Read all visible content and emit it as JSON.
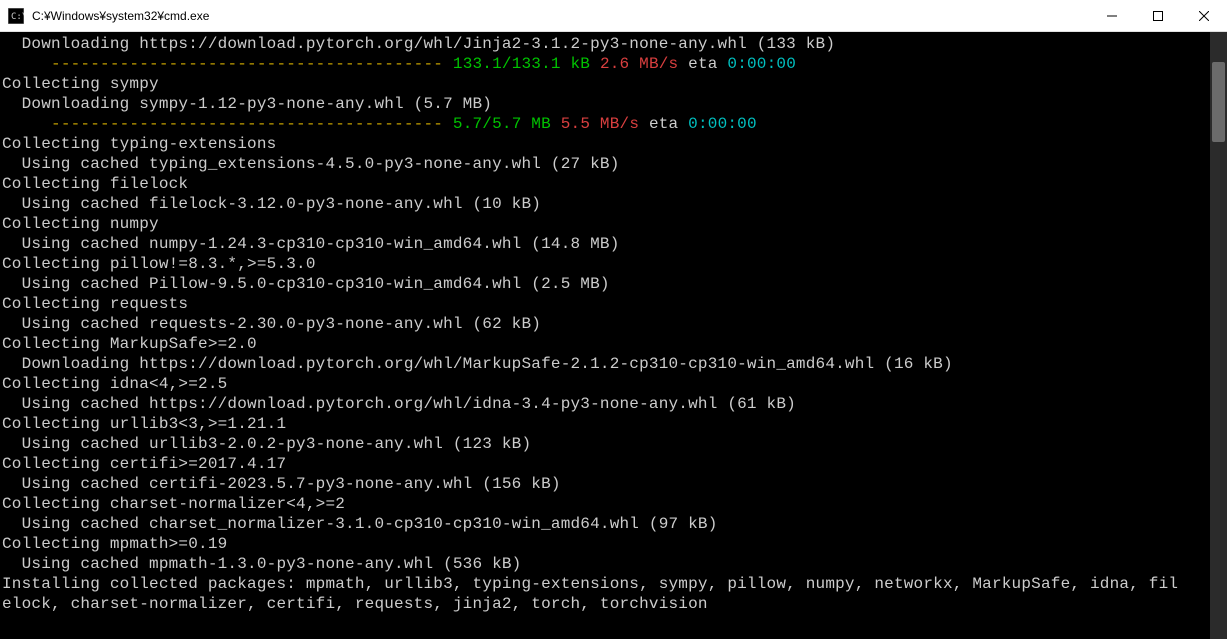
{
  "window": {
    "title": "C:¥Windows¥system32¥cmd.exe",
    "icon_label": "cmd-icon"
  },
  "progress_bar_dashes": "---------------------------------------- ",
  "lines": [
    {
      "type": "text",
      "indent": 1,
      "text": "Downloading https://download.pytorch.org/whl/Jinja2-3.1.2-py3-none-any.whl (133 kB)"
    },
    {
      "type": "progress",
      "size": "133.1/133.1 kB",
      "speed": "2.6 MB/s",
      "eta_label": "eta",
      "eta": "0:00:00"
    },
    {
      "type": "text",
      "indent": 0,
      "text": "Collecting sympy"
    },
    {
      "type": "text",
      "indent": 1,
      "text": "Downloading sympy-1.12-py3-none-any.whl (5.7 MB)"
    },
    {
      "type": "progress",
      "size": "5.7/5.7 MB",
      "speed": "5.5 MB/s",
      "eta_label": "eta",
      "eta": "0:00:00"
    },
    {
      "type": "text",
      "indent": 0,
      "text": "Collecting typing-extensions"
    },
    {
      "type": "text",
      "indent": 1,
      "text": "Using cached typing_extensions-4.5.0-py3-none-any.whl (27 kB)"
    },
    {
      "type": "text",
      "indent": 0,
      "text": "Collecting filelock"
    },
    {
      "type": "text",
      "indent": 1,
      "text": "Using cached filelock-3.12.0-py3-none-any.whl (10 kB)"
    },
    {
      "type": "text",
      "indent": 0,
      "text": "Collecting numpy"
    },
    {
      "type": "text",
      "indent": 1,
      "text": "Using cached numpy-1.24.3-cp310-cp310-win_amd64.whl (14.8 MB)"
    },
    {
      "type": "text",
      "indent": 0,
      "text": "Collecting pillow!=8.3.*,>=5.3.0"
    },
    {
      "type": "text",
      "indent": 1,
      "text": "Using cached Pillow-9.5.0-cp310-cp310-win_amd64.whl (2.5 MB)"
    },
    {
      "type": "text",
      "indent": 0,
      "text": "Collecting requests"
    },
    {
      "type": "text",
      "indent": 1,
      "text": "Using cached requests-2.30.0-py3-none-any.whl (62 kB)"
    },
    {
      "type": "text",
      "indent": 0,
      "text": "Collecting MarkupSafe>=2.0"
    },
    {
      "type": "text",
      "indent": 1,
      "text": "Downloading https://download.pytorch.org/whl/MarkupSafe-2.1.2-cp310-cp310-win_amd64.whl (16 kB)"
    },
    {
      "type": "text",
      "indent": 0,
      "text": "Collecting idna<4,>=2.5"
    },
    {
      "type": "text",
      "indent": 1,
      "text": "Using cached https://download.pytorch.org/whl/idna-3.4-py3-none-any.whl (61 kB)"
    },
    {
      "type": "text",
      "indent": 0,
      "text": "Collecting urllib3<3,>=1.21.1"
    },
    {
      "type": "text",
      "indent": 1,
      "text": "Using cached urllib3-2.0.2-py3-none-any.whl (123 kB)"
    },
    {
      "type": "text",
      "indent": 0,
      "text": "Collecting certifi>=2017.4.17"
    },
    {
      "type": "text",
      "indent": 1,
      "text": "Using cached certifi-2023.5.7-py3-none-any.whl (156 kB)"
    },
    {
      "type": "text",
      "indent": 0,
      "text": "Collecting charset-normalizer<4,>=2"
    },
    {
      "type": "text",
      "indent": 1,
      "text": "Using cached charset_normalizer-3.1.0-cp310-cp310-win_amd64.whl (97 kB)"
    },
    {
      "type": "text",
      "indent": 0,
      "text": "Collecting mpmath>=0.19"
    },
    {
      "type": "text",
      "indent": 1,
      "text": "Using cached mpmath-1.3.0-py3-none-any.whl (536 kB)"
    },
    {
      "type": "wrap",
      "text1": "Installing collected packages: mpmath, urllib3, typing-extensions, sympy, pillow, numpy, networkx, MarkupSafe, idna, fil",
      "text2": "elock, charset-normalizer, certifi, requests, jinja2, torch, torchvision"
    }
  ]
}
